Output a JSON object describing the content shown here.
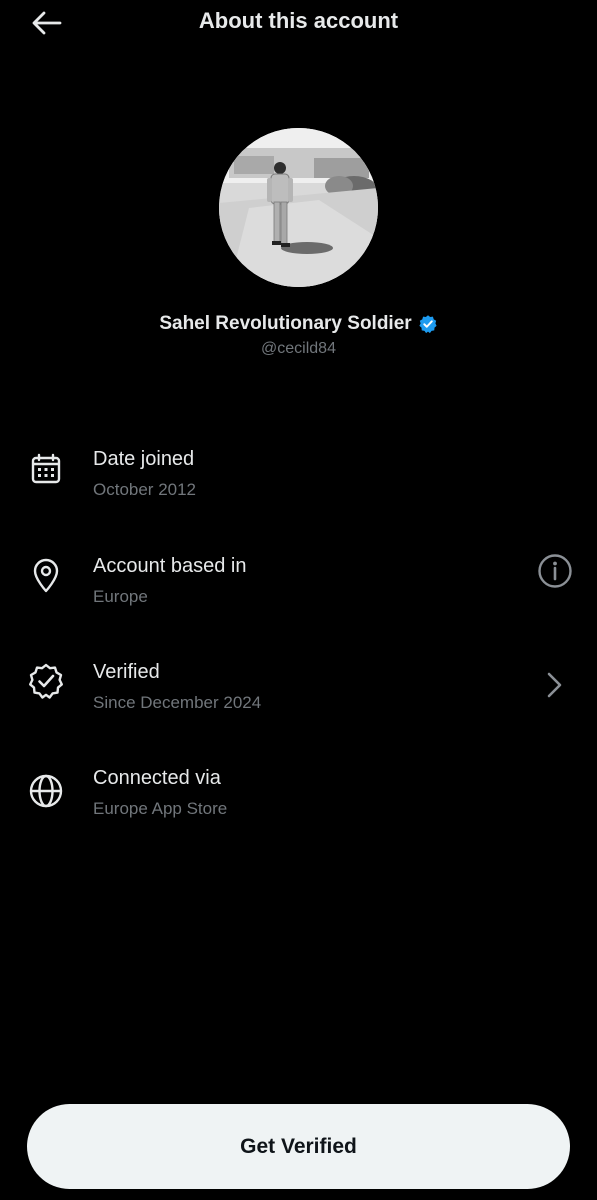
{
  "header": {
    "title": "About this account",
    "back_icon": "arrow-left-icon"
  },
  "profile": {
    "display_name": "Sahel Revolutionary Soldier",
    "handle": "@cecild84",
    "verified_badge_icon": "verified-badge-icon",
    "badge_color": "#1d9bf0"
  },
  "info": [
    {
      "icon": "calendar-icon",
      "title": "Date joined",
      "value": "October 2012"
    },
    {
      "icon": "location-pin-icon",
      "title": "Account based in",
      "value": "Europe",
      "action_icon": "info-circle-icon"
    },
    {
      "icon": "verified-outline-icon",
      "title": "Verified",
      "value": "Since December 2024",
      "action_icon": "chevron-right-icon"
    },
    {
      "icon": "globe-icon",
      "title": "Connected via",
      "value": "Europe App Store"
    }
  ],
  "cta": {
    "label": "Get Verified"
  },
  "colors": {
    "background": "#000000",
    "primary_text": "#e7e9ea",
    "secondary_text": "#71767b",
    "button_bg": "#eff3f4",
    "button_text": "#0f1419"
  }
}
